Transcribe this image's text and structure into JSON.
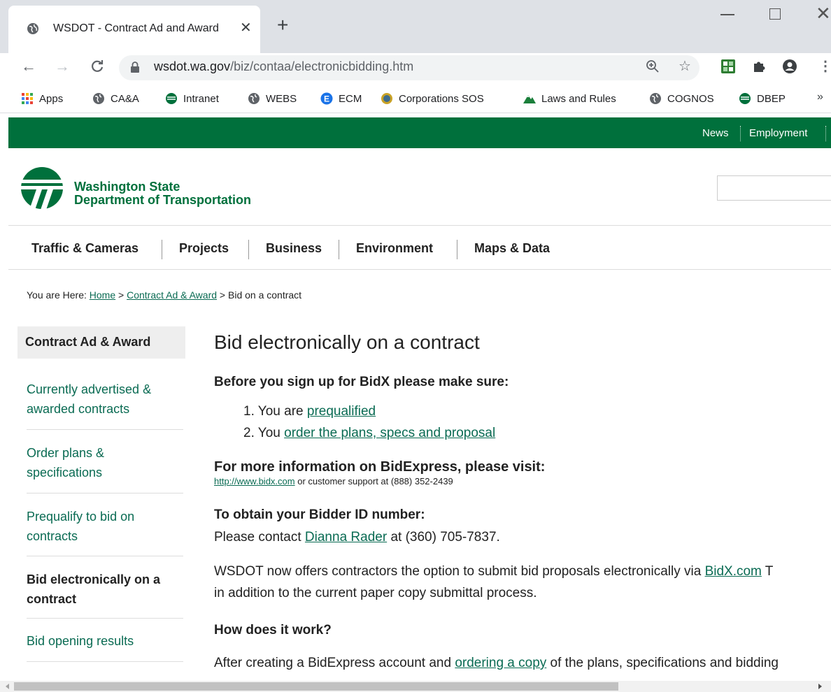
{
  "browser": {
    "tab_title": "WSDOT - Contract Ad and Award",
    "tab_close": "✕",
    "new_tab": "+",
    "url_domain": "wsdot.wa.gov",
    "url_path": "/biz/contaa/electronicbidding.htm"
  },
  "bookmarks": {
    "items": [
      "Apps",
      "CA&A",
      "Intranet",
      "WEBS",
      "ECM",
      "Corporations SOS",
      "Laws and Rules",
      "COGNOS",
      "DBEP"
    ],
    "more": "»"
  },
  "site": {
    "utility_links": [
      "News",
      "Employment"
    ],
    "org_line1": "Washington State",
    "org_line2": "Department of Transportation",
    "nav": [
      "Traffic & Cameras",
      "Projects",
      "Business",
      "Environment",
      "Maps & Data"
    ]
  },
  "breadcrumb": {
    "prefix": "You are Here: ",
    "home": "Home",
    "sep1": " > ",
    "section": "Contract Ad & Award",
    "sep2": " > ",
    "current": "Bid on a contract"
  },
  "sidebar": {
    "heading": "Contract Ad & Award",
    "items": [
      "Currently advertised & awarded contracts",
      "Order plans & specifications",
      "Prequalify to bid on contracts",
      "Bid electronically on a contract",
      "Bid opening results"
    ]
  },
  "content": {
    "title": "Bid electronically on a contract",
    "before_heading": "Before you sign up for BidX please make sure:",
    "list": [
      {
        "num": "1. You are ",
        "link": "prequalified"
      },
      {
        "num": "2. You ",
        "link": "order the plans, specs and proposal"
      }
    ],
    "more_info_heading": "For more information on BidExpress, please visit:",
    "bidx_link": "http://www.bidx.com",
    "support_text": " or customer support at (888) 352-2439",
    "bidder_id_heading": "To obtain your Bidder ID number:",
    "contact_prefix": "Please contact ",
    "contact_name": "Dianna Rader",
    "contact_suffix": " at (360) 705-7837.",
    "para1_a": "WSDOT now offers contractors the option to submit bid proposals electronically via ",
    "para1_link": "BidX.com",
    "para1_b": " T",
    "para1_line2": "in addition to the current paper copy submittal process.",
    "how_heading": "How does it work?",
    "para2_a": "After creating a BidExpress account and ",
    "para2_link": "ordering a copy",
    "para2_b": " of the plans, specifications and bidding"
  }
}
